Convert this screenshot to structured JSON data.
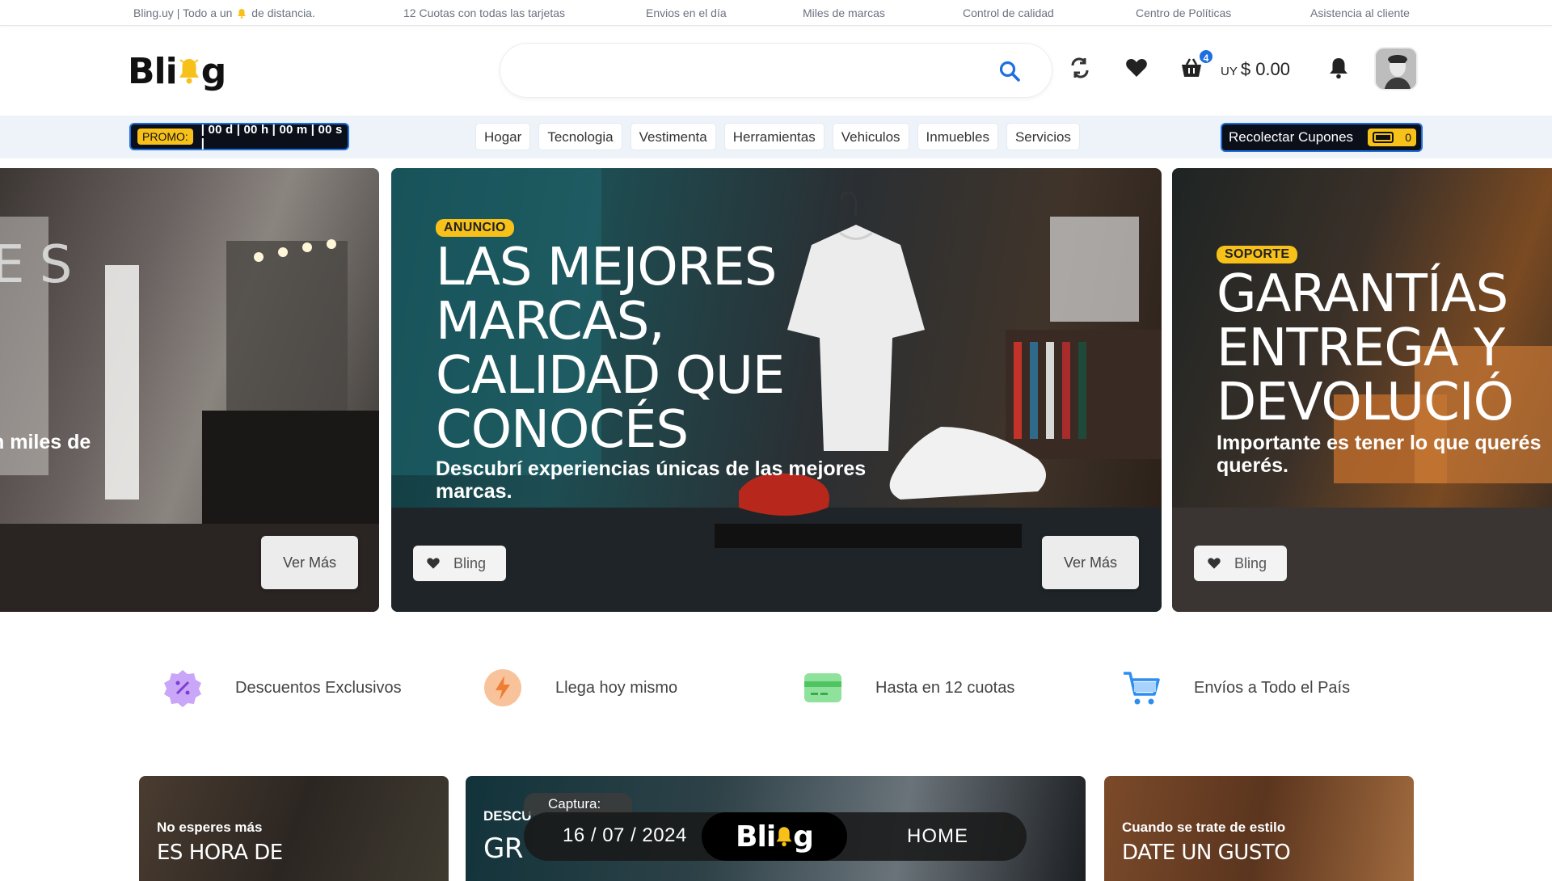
{
  "topbar": {
    "item1_pre": "Bling.uy | Todo a un",
    "item1_post": "de distancia.",
    "item2": "12 Cuotas con todas las tarjetas",
    "item3": "Envios en el día",
    "item4": "Miles de marcas",
    "item5": "Control de calidad",
    "item6": "Centro de Políticas",
    "item7": "Asistencia al cliente"
  },
  "header": {
    "logo_pre": "Bli",
    "logo_post": "g",
    "search_placeholder": "",
    "cart_count": "4",
    "currency": "UY",
    "price": "$ 0.00"
  },
  "nav": {
    "promo_tag": "PROMO:",
    "timer": "| 00 d | 00 h | 00 m | 00 s |",
    "categories": [
      "Hogar",
      "Tecnologia",
      "Vestimenta",
      "Herramientas",
      "Vehiculos",
      "Inmuebles",
      "Servicios"
    ],
    "coupons_label": "Recolectar Cupones",
    "coupons_count": "0"
  },
  "banners": {
    "left": {
      "big_partial": "E S",
      "sub_partial": "n miles de",
      "button": "Ver Más"
    },
    "middle": {
      "badge": "ANUNCIO",
      "headline": "LAS MEJORES MARCAS, CALIDAD QUE CONOCÉS",
      "line1": "LAS MEJORES",
      "line2": "MARCAS,",
      "line3": "CALIDAD QUE",
      "line4": "CONOCÉS",
      "sub": "Descubrí experiencias únicas de las mejores marcas.",
      "bling_button": "Bling",
      "button": "Ver Más"
    },
    "right": {
      "badge": "SOPORTE",
      "line1": "GARANTÍAS",
      "line2": "ENTREGA Y",
      "line3": "DEVOLUCIÓ",
      "sub": "Importante es tener lo que querés querés.",
      "bling_button": "Bling"
    }
  },
  "features": [
    {
      "icon": "discount-badge-icon",
      "label": "Descuentos Exclusivos",
      "color": "#b388f5"
    },
    {
      "icon": "lightning-icon",
      "label": "Llega hoy mismo",
      "color": "#f5a05a"
    },
    {
      "icon": "card-icon",
      "label": "Hasta en 12 cuotas",
      "color": "#7ed98c"
    },
    {
      "icon": "cart-icon",
      "label": "Envíos a Todo el País",
      "color": "#2d8ef0"
    }
  ],
  "cards": {
    "c1_small": "No esperes más",
    "c1_big": "ES HORA DE",
    "c2_small": "DESCU",
    "c2_big": "GR",
    "c3_small": "Cuando se trate de estilo",
    "c3_big": "DATE UN GUSTO"
  },
  "overlay": {
    "caption": "Captura:",
    "date": "16 / 07 / 2024",
    "logo_pre": "Bli",
    "logo_post": "g",
    "home": "HOME"
  },
  "colors": {
    "accent": "#1d6fe0",
    "yellow": "#f7c11a",
    "dark": "#0b0f1a"
  }
}
